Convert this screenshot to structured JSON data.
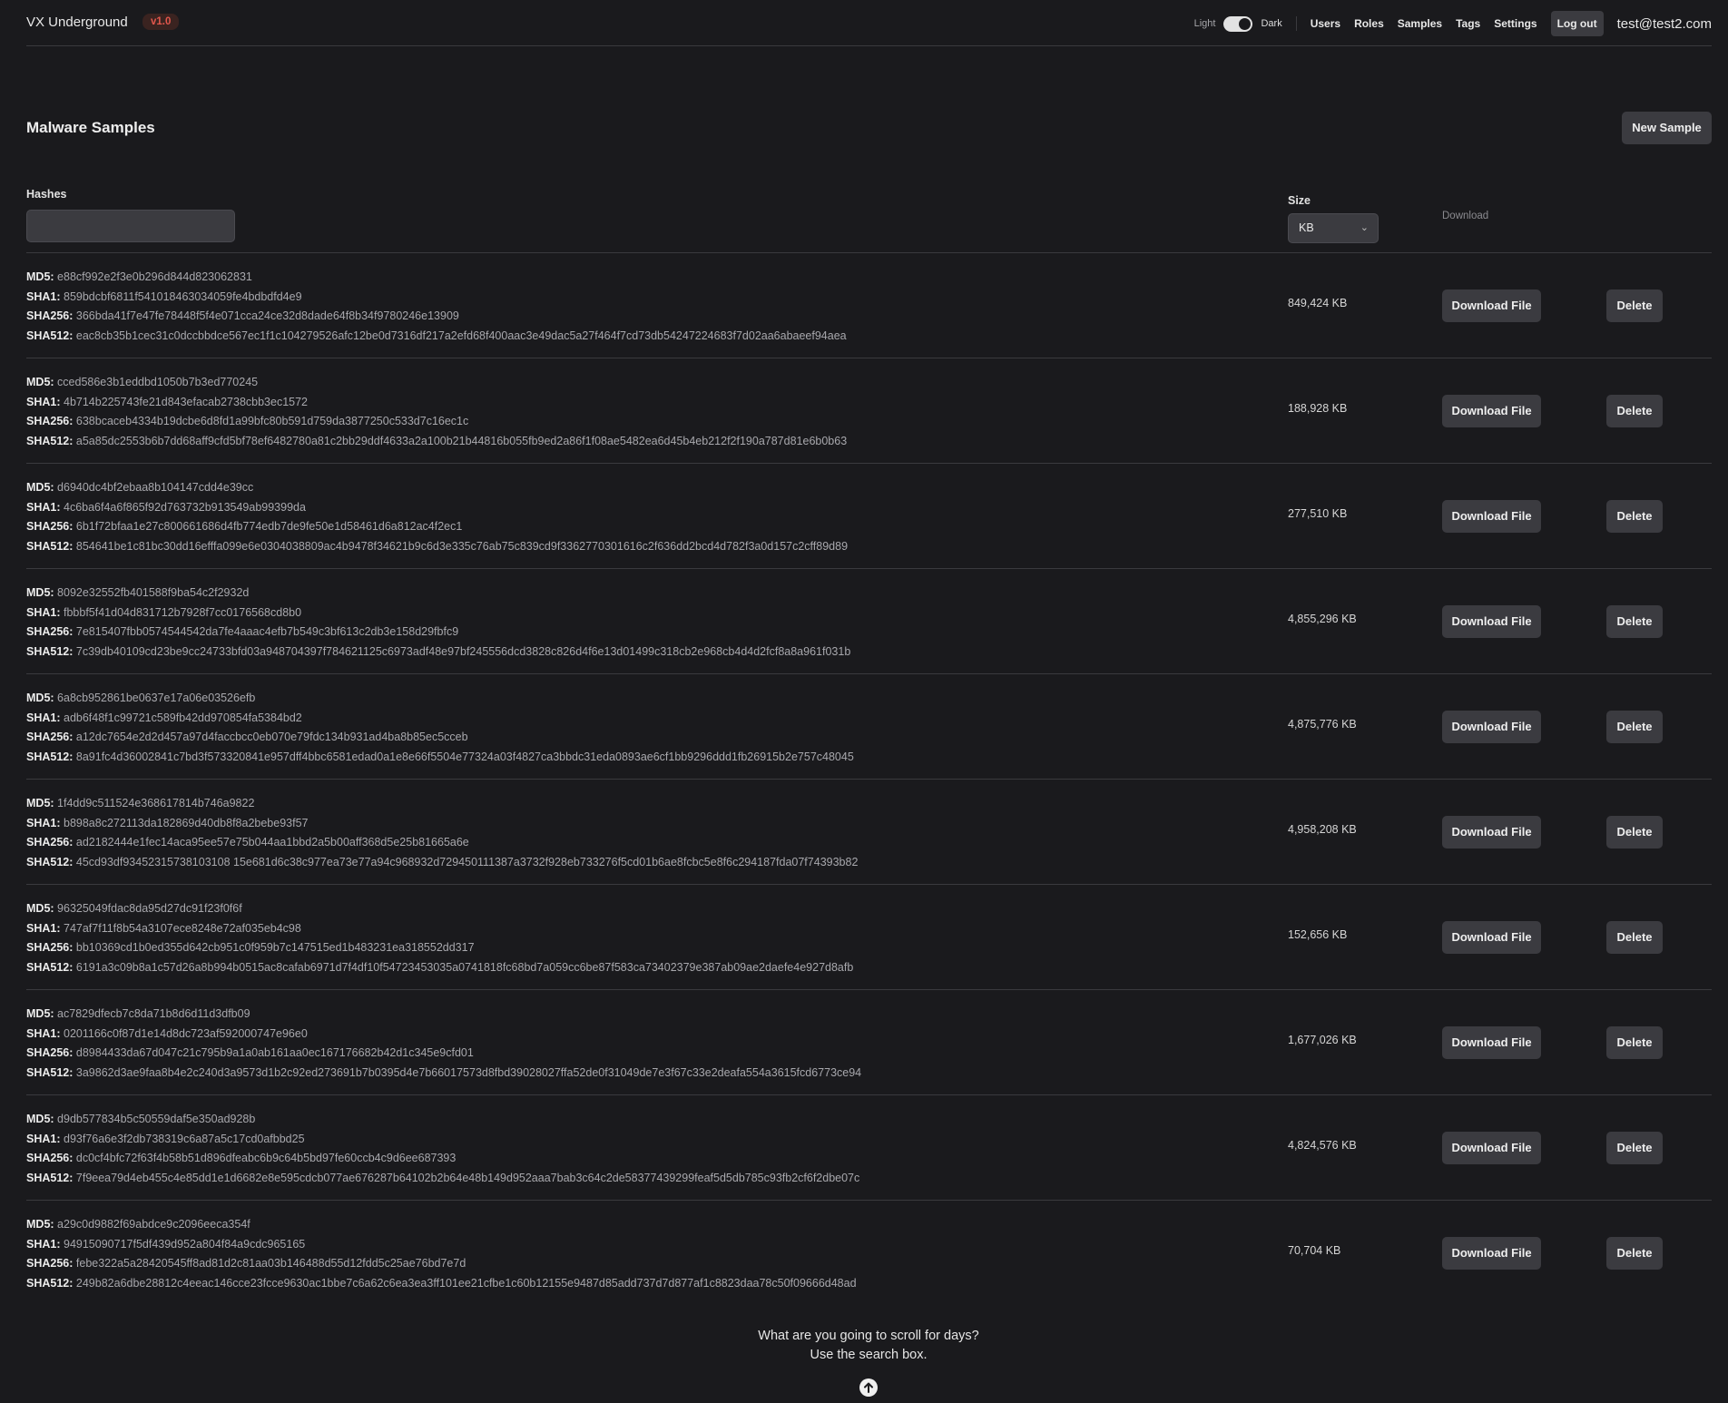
{
  "app": {
    "title": "VX Underground",
    "version": "v1.0"
  },
  "nav": {
    "theme_light": "Light",
    "theme_dark": "Dark",
    "theme_mode": "dark",
    "links": [
      "Users",
      "Roles",
      "Samples",
      "Tags",
      "Settings"
    ],
    "logout": "Log out",
    "user_email": "test@test2.com"
  },
  "page": {
    "title": "Malware Samples",
    "new_sample_label": "New Sample"
  },
  "filters": {
    "hashes_label": "Hashes",
    "hashes_value": "",
    "size_label": "Size",
    "size_unit": "KB",
    "download_label": "Download"
  },
  "hash_keys": {
    "md5": "MD5:",
    "sha1": "SHA1:",
    "sha256": "SHA256:",
    "sha512": "SHA512:"
  },
  "row_actions": {
    "download": "Download File",
    "delete": "Delete"
  },
  "samples": [
    {
      "md5": "e88cf992e2f3e0b296d844d823062831",
      "sha1": "859bdcbf6811f541018463034059fe4bdbdfd4e9",
      "sha256": "366bda41f7e47fe78448f5f4e071cca24ce32d8dade64f8b34f9780246e13909",
      "sha512": "eac8cb35b1cec31c0dccbbdce567ec1f1c104279526afc12be0d7316df217a2efd68f400aac3e49dac5a27f464f7cd73db54247224683f7d02aa6abaeef94aea",
      "size": "849,424 KB"
    },
    {
      "md5": "cced586e3b1eddbd1050b7b3ed770245",
      "sha1": "4b714b225743fe21d843efacab2738cbb3ec1572",
      "sha256": "638bcaceb4334b19dcbe6d8fd1a99bfc80b591d759da3877250c533d7c16ec1c",
      "sha512": "a5a85dc2553b6b7dd68aff9cfd5bf78ef6482780a81c2bb29ddf4633a2a100b21b44816b055fb9ed2a86f1f08ae5482ea6d45b4eb212f2f190a787d81e6b0b63",
      "size": "188,928 KB"
    },
    {
      "md5": "d6940dc4bf2ebaa8b104147cdd4e39cc",
      "sha1": "4c6ba6f4a6f865f92d763732b913549ab99399da",
      "sha256": "6b1f72bfaa1e27c800661686d4fb774edb7de9fe50e1d58461d6a812ac4f2ec1",
      "sha512": "854641be1c81bc30dd16efffa099e6e0304038809ac4b9478f34621b9c6d3e335c76ab75c839cd9f3362770301616c2f636dd2bcd4d782f3a0d157c2cff89d89",
      "size": "277,510 KB"
    },
    {
      "md5": "8092e32552fb401588f9ba54c2f2932d",
      "sha1": "fbbbf5f41d04d831712b7928f7cc0176568cd8b0",
      "sha256": "7e815407fbb0574544542da7fe4aaac4efb7b549c3bf613c2db3e158d29fbfc9",
      "sha512": "7c39db40109cd23be9cc24733bfd03a948704397f784621125c6973adf48e97bf245556dcd3828c826d4f6e13d01499c318cb2e968cb4d4d2fcf8a8a961f031b",
      "size": "4,855,296 KB"
    },
    {
      "md5": "6a8cb952861be0637e17a06e03526efb",
      "sha1": "adb6f48f1c99721c589fb42dd970854fa5384bd2",
      "sha256": "a12dc7654e2d2d457a97d4faccbcc0eb070e79fdc134b931ad4ba8b85ec5cceb",
      "sha512": "8a91fc4d36002841c7bd3f573320841e957dff4bbc6581edad0a1e8e66f5504e77324a03f4827ca3bbdc31eda0893ae6cf1bb9296ddd1fb26915b2e757c48045",
      "size": "4,875,776 KB"
    },
    {
      "md5": "1f4dd9c511524e368617814b746a9822",
      "sha1": "b898a8c272113da182869d40db8f8a2bebe93f57",
      "sha256": "ad2182444e1fec14aca95ee57e75b044aa1bbd2a5b00aff368d5e25b81665a6e",
      "sha512": "45cd93df93452315738103108 15e681d6c38c977ea73e77a94c968932d729450111387a3732f928eb733276f5cd01b6ae8fcbc5e8f6c294187fda07f74393b82",
      "size": "4,958,208 KB"
    },
    {
      "md5": "96325049fdac8da95d27dc91f23f0f6f",
      "sha1": "747af7f11f8b54a3107ece8248e72af035eb4c98",
      "sha256": "bb10369cd1b0ed355d642cb951c0f959b7c147515ed1b483231ea318552dd317",
      "sha512": "6191a3c09b8a1c57d26a8b994b0515ac8cafab6971d7f4df10f54723453035a0741818fc68bd7a059cc6be87f583ca73402379e387ab09ae2daefe4e927d8afb",
      "size": "152,656 KB"
    },
    {
      "md5": "ac7829dfecb7c8da71b8d6d11d3dfb09",
      "sha1": "0201166c0f87d1e14d8dc723af592000747e96e0",
      "sha256": "d8984433da67d047c21c795b9a1a0ab161aa0ec167176682b42d1c345e9cfd01",
      "sha512": "3a9862d3ae9faa8b4e2c240d3a9573d1b2c92ed273691b7b0395d4e7b66017573d8fbd39028027ffa52de0f31049de7e3f67c33e2deafa554a3615fcd6773ce94",
      "size": "1,677,026 KB"
    },
    {
      "md5": "d9db577834b5c50559daf5e350ad928b",
      "sha1": "d93f76a6e3f2db738319c6a87a5c17cd0afbbd25",
      "sha256": "dc0cf4bfc72f63f4b58b51d896dfeabc6b9c64b5bd97fe60ccb4c9d6ee687393",
      "sha512": "7f9eea79d4eb455c4e85dd1e1d6682e8e595cdcb077ae676287b64102b2b64e48b149d952aaa7bab3c64c2de58377439299feaf5d5db785c93fb2cf6f2dbe07c",
      "size": "4,824,576 KB"
    },
    {
      "md5": "a29c0d9882f69abdce9c2096eeca354f",
      "sha1": "94915090717f5df439d952a804f84a9cdc965165",
      "sha256": "febe322a5a28420545ff8ad81d2c81aa03b146488d55d12fdd5c25ae76bd7e7d",
      "sha512": "249b82a6dbe28812c4eeac146cce23fcce9630ac1bbe7c6a62c6ea3ea3ff101ee21cfbe1c60b12155e9487d85add737d7d877af1c8823daa78c50f09666d48ad",
      "size": "70,704 KB"
    }
  ],
  "footer": {
    "line1": "What are you going to scroll for days?",
    "line2": "Use the search box."
  }
}
